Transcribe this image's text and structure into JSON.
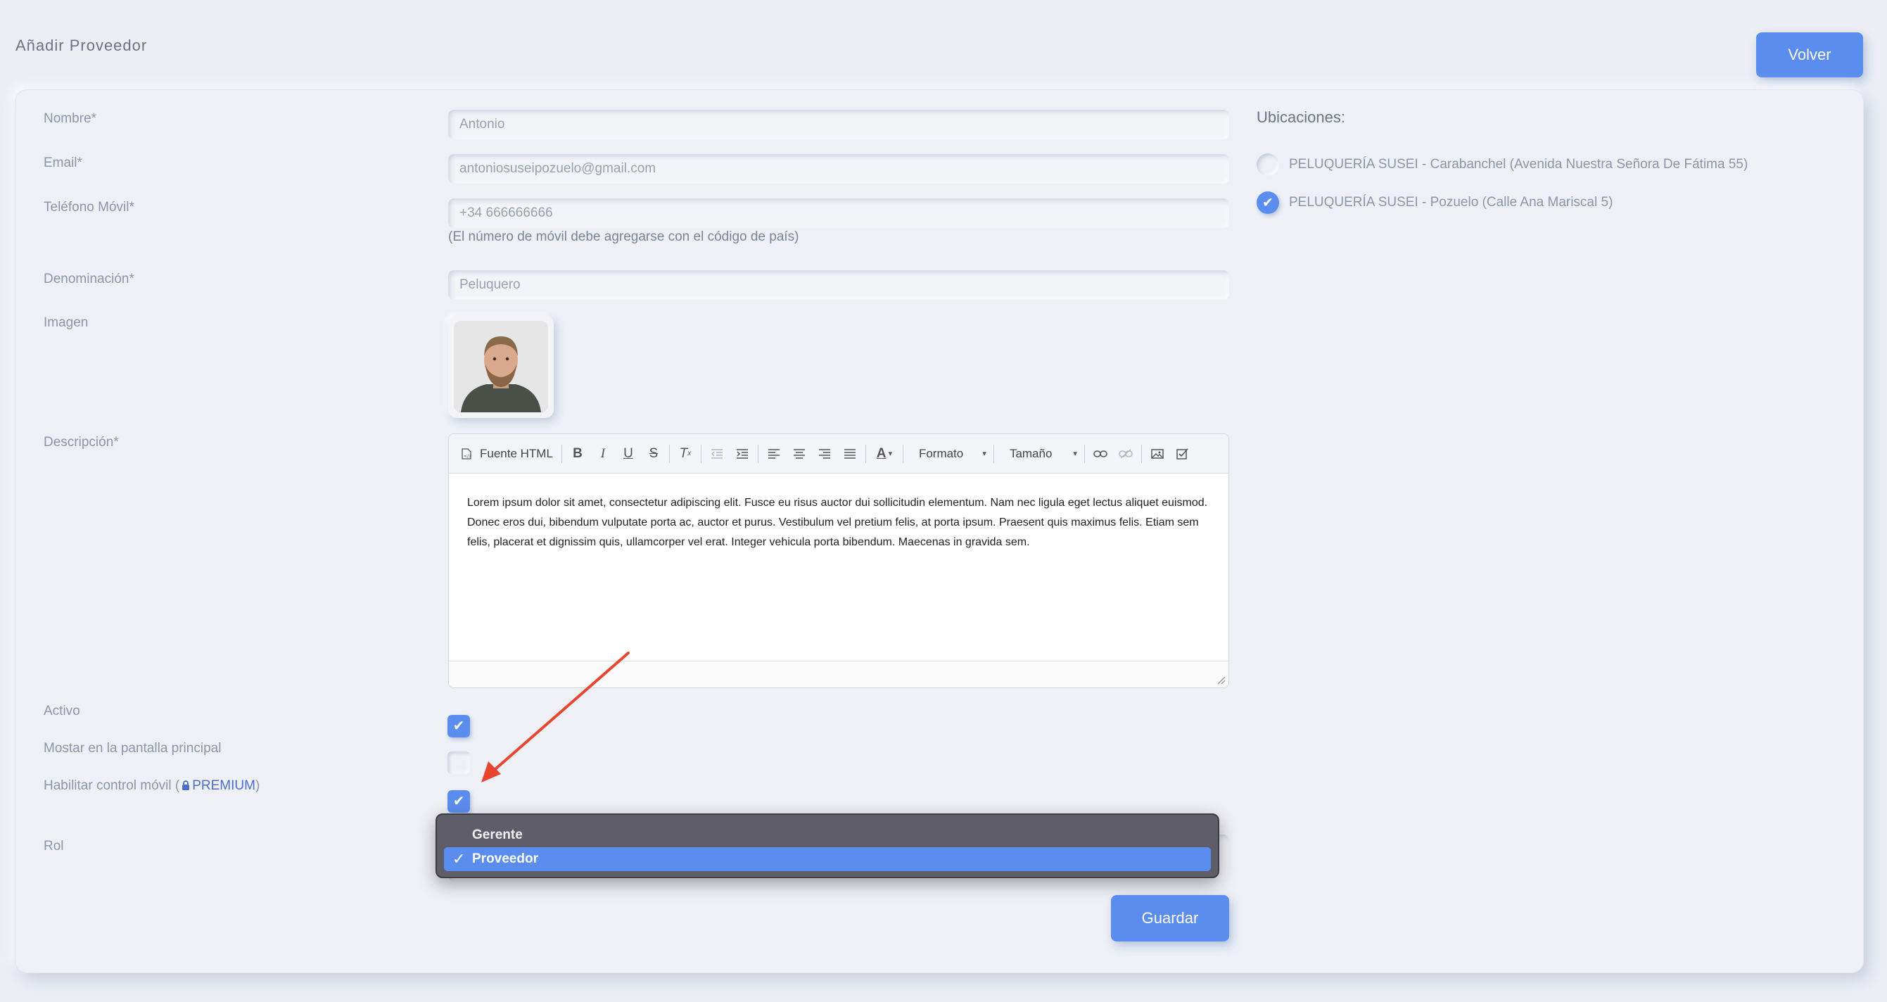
{
  "header": {
    "title": "Añadir Proveedor",
    "back_label": "Volver"
  },
  "form": {
    "nombre": {
      "label": "Nombre*",
      "value": "Antonio"
    },
    "email": {
      "label": "Email*",
      "value": "antoniosuseipozuelo@gmail.com"
    },
    "telefono": {
      "label": "Teléfono Móvil*",
      "value": "+34 666666666",
      "hint": "(El número de móvil debe agregarse con el código de país)"
    },
    "denominacion": {
      "label": "Denominación*",
      "value": "Peluquero"
    },
    "imagen": {
      "label": "Imagen"
    },
    "descripcion": {
      "label": "Descripción*",
      "text": "Lorem ipsum dolor sit amet, consectetur adipiscing elit. Fusce eu risus auctor dui sollicitudin elementum. Nam nec ligula eget lectus aliquet euismod. Donec eros dui, bibendum vulputate porta ac, auctor et purus. Vestibulum vel pretium felis, at porta ipsum. Praesent quis maximus felis. Etiam sem felis, placerat et dignissim quis, ullamcorper vel erat. Integer vehicula porta bibendum. Maecenas in gravida sem."
    },
    "activo": {
      "label": "Activo",
      "checked": true
    },
    "mostrar": {
      "label": "Mostar en la pantalla principal",
      "checked": false
    },
    "habilitar": {
      "label_before": "Habilitar control móvil (",
      "premium": "PREMIUM",
      "label_after": ")",
      "checked": true
    },
    "rol": {
      "label": "Rol",
      "options": [
        "Gerente",
        "Proveedor"
      ],
      "selected": "Proveedor"
    },
    "save_label": "Guardar"
  },
  "toolbar": {
    "source_label": "Fuente HTML",
    "format_label": "Formato",
    "size_label": "Tamaño",
    "icons": [
      "source-icon",
      "bold-icon",
      "italic-icon",
      "underline-icon",
      "strikethrough-icon",
      "remove-format-icon",
      "outdent-icon",
      "indent-icon",
      "align-left-icon",
      "align-center-icon",
      "align-right-icon",
      "align-justify-icon",
      "text-color-icon",
      "link-icon",
      "unlink-icon",
      "image-icon",
      "checkbox-icon"
    ]
  },
  "ubicaciones": {
    "title": "Ubicaciones:",
    "items": [
      {
        "label": "PELUQUERÍA SUSEI - Carabanchel (Avenida Nuestra Señora De Fátima 55)",
        "checked": false
      },
      {
        "label": "PELUQUERÍA SUSEI - Pozuelo (Calle Ana Mariscal 5)",
        "checked": true
      }
    ]
  },
  "colors": {
    "accent": "#5b8def",
    "annotation_arrow": "#e8452f",
    "dropdown_bg": "#5f5d67"
  }
}
